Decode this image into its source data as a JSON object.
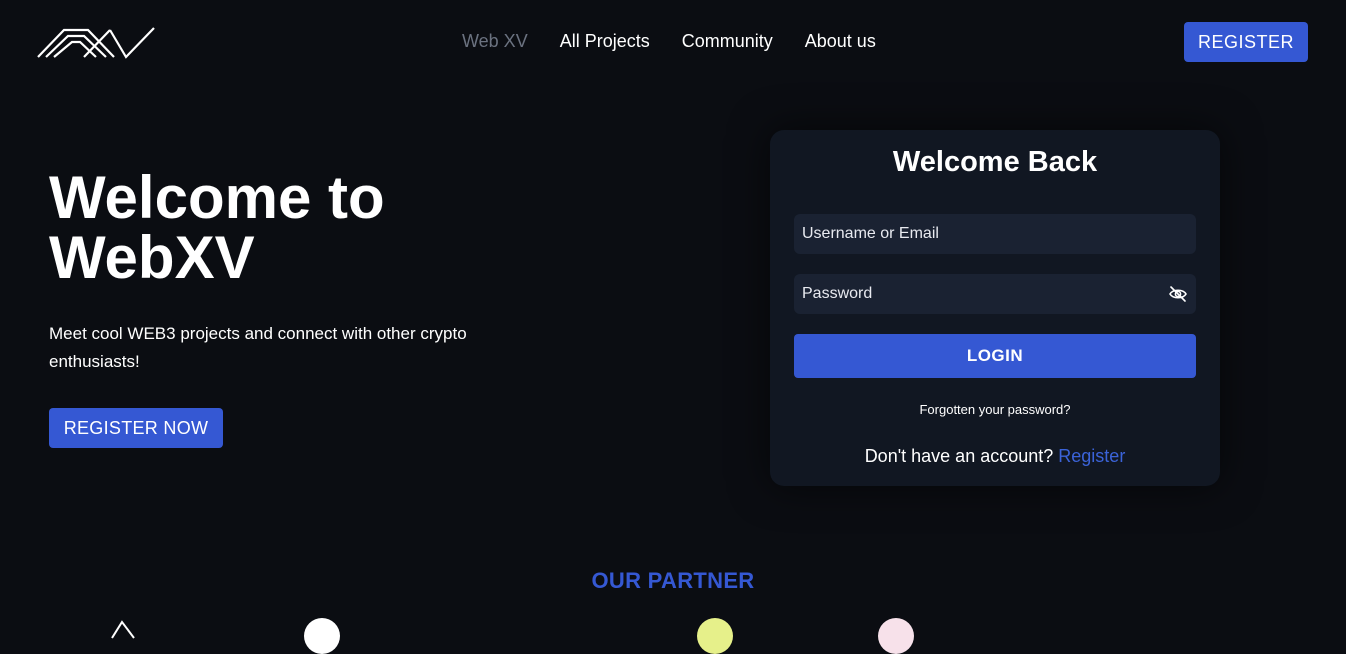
{
  "nav": {
    "items": [
      {
        "label": "Web XV",
        "active": true
      },
      {
        "label": "All Projects",
        "active": false
      },
      {
        "label": "Community",
        "active": false
      },
      {
        "label": "About us",
        "active": false
      }
    ],
    "register_label": "REGISTER"
  },
  "hero": {
    "title_line1": "Welcome to",
    "title_line2": "WebXV",
    "subtitle": "Meet cool WEB3 projects and connect with other crypto enthusiasts!",
    "cta_label": "REGISTER NOW"
  },
  "login": {
    "title": "Welcome Back",
    "username_placeholder": "Username or Email",
    "password_placeholder": "Password",
    "login_label": "LOGIN",
    "forgot_label": "Forgotten your password?",
    "no_account_text": "Don't have an account?",
    "register_link": "Register"
  },
  "partners": {
    "title": "OUR PARTNER"
  },
  "colors": {
    "background": "#0b0d12",
    "accent": "#3558d3",
    "card": "#111722",
    "field": "#1a2232",
    "nav_active": "#6b7280"
  }
}
